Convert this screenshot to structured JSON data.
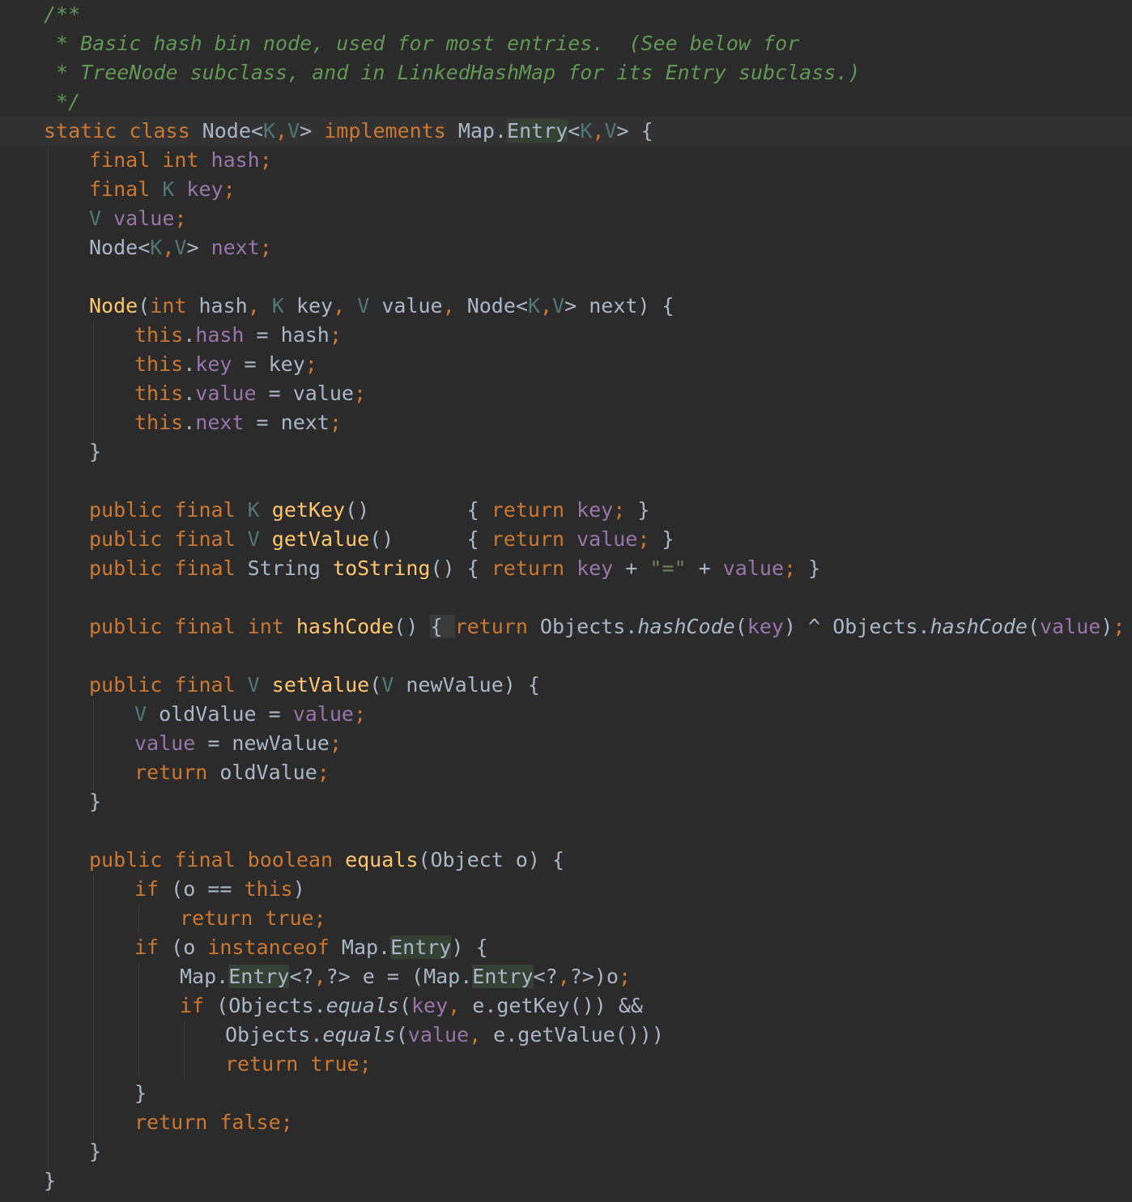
{
  "editor": {
    "colors": {
      "background": "#2b2b2b",
      "current_line": "#323232",
      "doc_comment": "#629755",
      "keyword": "#cc7832",
      "field": "#9876aa",
      "type_param": "#507874",
      "plain": "#a9b7c6",
      "method_decl": "#ffc66d",
      "string": "#6a8759"
    },
    "lines": [
      {
        "indent": 0,
        "tokens": [
          [
            "c-doc",
            "/**"
          ]
        ]
      },
      {
        "indent": 0,
        "tokens": [
          [
            "c-doc",
            " * Basic hash bin node, used for most entries.  (See below for"
          ]
        ]
      },
      {
        "indent": 0,
        "tokens": [
          [
            "c-doc",
            " * TreeNode subclass, and in LinkedHashMap for its Entry subclass.)"
          ]
        ]
      },
      {
        "indent": 0,
        "tokens": [
          [
            "c-doc",
            " */"
          ]
        ]
      },
      {
        "indent": 0,
        "current": true,
        "tokens": [
          [
            "c-kw",
            "static class "
          ],
          [
            "c-plain",
            "Node<"
          ],
          [
            "c-type",
            "K"
          ],
          [
            "c-punc",
            ","
          ],
          [
            "c-type",
            "V"
          ],
          [
            "c-plain",
            "> "
          ],
          [
            "c-kw",
            "implements "
          ],
          [
            "c-plain",
            "Map."
          ],
          [
            "c-plain hl-entry",
            "Entry"
          ],
          [
            "c-plain",
            "<"
          ],
          [
            "c-type",
            "K"
          ],
          [
            "c-punc",
            ","
          ],
          [
            "c-type",
            "V"
          ],
          [
            "c-plain",
            "> {"
          ]
        ]
      },
      {
        "indent": 1,
        "tokens": [
          [
            "c-kw",
            "final int "
          ],
          [
            "c-field",
            "hash"
          ],
          [
            "c-punc",
            ";"
          ]
        ]
      },
      {
        "indent": 1,
        "tokens": [
          [
            "c-kw",
            "final "
          ],
          [
            "c-type",
            "K "
          ],
          [
            "c-field",
            "key"
          ],
          [
            "c-punc",
            ";"
          ]
        ]
      },
      {
        "indent": 1,
        "tokens": [
          [
            "c-type",
            "V "
          ],
          [
            "c-field",
            "value"
          ],
          [
            "c-punc",
            ";"
          ]
        ]
      },
      {
        "indent": 1,
        "tokens": [
          [
            "c-plain",
            "Node<"
          ],
          [
            "c-type",
            "K"
          ],
          [
            "c-punc",
            ","
          ],
          [
            "c-type",
            "V"
          ],
          [
            "c-plain",
            "> "
          ],
          [
            "c-field",
            "next"
          ],
          [
            "c-punc",
            ";"
          ]
        ]
      },
      {
        "indent": 0,
        "tokens": []
      },
      {
        "indent": 1,
        "tokens": [
          [
            "c-method",
            "Node"
          ],
          [
            "c-plain",
            "("
          ],
          [
            "c-kw",
            "int "
          ],
          [
            "c-plain",
            "hash"
          ],
          [
            "c-punc",
            ", "
          ],
          [
            "c-type",
            "K "
          ],
          [
            "c-plain",
            "key"
          ],
          [
            "c-punc",
            ", "
          ],
          [
            "c-type",
            "V "
          ],
          [
            "c-plain",
            "value"
          ],
          [
            "c-punc",
            ", "
          ],
          [
            "c-plain",
            "Node<"
          ],
          [
            "c-type",
            "K"
          ],
          [
            "c-punc",
            ","
          ],
          [
            "c-type",
            "V"
          ],
          [
            "c-plain",
            "> next) {"
          ]
        ]
      },
      {
        "indent": 2,
        "tokens": [
          [
            "c-kw",
            "this"
          ],
          [
            "c-plain",
            "."
          ],
          [
            "c-field",
            "hash "
          ],
          [
            "c-plain",
            "= hash"
          ],
          [
            "c-punc",
            ";"
          ]
        ]
      },
      {
        "indent": 2,
        "tokens": [
          [
            "c-kw",
            "this"
          ],
          [
            "c-plain",
            "."
          ],
          [
            "c-field",
            "key "
          ],
          [
            "c-plain",
            "= key"
          ],
          [
            "c-punc",
            ";"
          ]
        ]
      },
      {
        "indent": 2,
        "tokens": [
          [
            "c-kw",
            "this"
          ],
          [
            "c-plain",
            "."
          ],
          [
            "c-field",
            "value "
          ],
          [
            "c-plain",
            "= value"
          ],
          [
            "c-punc",
            ";"
          ]
        ]
      },
      {
        "indent": 2,
        "tokens": [
          [
            "c-kw",
            "this"
          ],
          [
            "c-plain",
            "."
          ],
          [
            "c-field",
            "next "
          ],
          [
            "c-plain",
            "= next"
          ],
          [
            "c-punc",
            ";"
          ]
        ]
      },
      {
        "indent": 1,
        "tokens": [
          [
            "c-plain",
            "}"
          ]
        ]
      },
      {
        "indent": 0,
        "tokens": []
      },
      {
        "indent": 1,
        "tokens": [
          [
            "c-kw",
            "public final "
          ],
          [
            "c-type",
            "K "
          ],
          [
            "c-method",
            "getKey"
          ],
          [
            "c-plain",
            "()        { "
          ],
          [
            "c-kw",
            "return "
          ],
          [
            "c-field",
            "key"
          ],
          [
            "c-punc",
            "; "
          ],
          [
            "c-plain",
            "}"
          ]
        ]
      },
      {
        "indent": 1,
        "tokens": [
          [
            "c-kw",
            "public final "
          ],
          [
            "c-type",
            "V "
          ],
          [
            "c-method",
            "getValue"
          ],
          [
            "c-plain",
            "()      { "
          ],
          [
            "c-kw",
            "return "
          ],
          [
            "c-field",
            "value"
          ],
          [
            "c-punc",
            "; "
          ],
          [
            "c-plain",
            "}"
          ]
        ]
      },
      {
        "indent": 1,
        "tokens": [
          [
            "c-kw",
            "public final "
          ],
          [
            "c-plain",
            "String "
          ],
          [
            "c-method",
            "toString"
          ],
          [
            "c-plain",
            "() { "
          ],
          [
            "c-kw",
            "return "
          ],
          [
            "c-field",
            "key "
          ],
          [
            "c-plain",
            "+ "
          ],
          [
            "c-str",
            "\"=\" "
          ],
          [
            "c-plain",
            "+ "
          ],
          [
            "c-field",
            "value"
          ],
          [
            "c-punc",
            "; "
          ],
          [
            "c-plain",
            "}"
          ]
        ]
      },
      {
        "indent": 0,
        "tokens": []
      },
      {
        "indent": 1,
        "tokens": [
          [
            "c-kw",
            "public final int "
          ],
          [
            "c-method",
            "hashCode"
          ],
          [
            "c-plain",
            "() "
          ],
          [
            "c-plain fold-box",
            "{ "
          ],
          [
            "c-kw",
            "return "
          ],
          [
            "c-plain",
            "Objects."
          ],
          [
            "c-italic",
            "hashCode"
          ],
          [
            "c-plain",
            "("
          ],
          [
            "c-field",
            "key"
          ],
          [
            "c-plain",
            ") ^ Objects."
          ],
          [
            "c-italic",
            "hashCode"
          ],
          [
            "c-plain",
            "("
          ],
          [
            "c-field",
            "value"
          ],
          [
            "c-plain",
            ")"
          ],
          [
            "c-punc",
            "; "
          ],
          [
            "c-plain fold-box",
            "}"
          ]
        ]
      },
      {
        "indent": 0,
        "tokens": []
      },
      {
        "indent": 1,
        "tokens": [
          [
            "c-kw",
            "public final "
          ],
          [
            "c-type",
            "V "
          ],
          [
            "c-method",
            "setValue"
          ],
          [
            "c-plain",
            "("
          ],
          [
            "c-type",
            "V "
          ],
          [
            "c-plain",
            "newValue) {"
          ]
        ]
      },
      {
        "indent": 2,
        "tokens": [
          [
            "c-type",
            "V "
          ],
          [
            "c-plain",
            "oldValue = "
          ],
          [
            "c-field",
            "value"
          ],
          [
            "c-punc",
            ";"
          ]
        ]
      },
      {
        "indent": 2,
        "tokens": [
          [
            "c-field",
            "value "
          ],
          [
            "c-plain",
            "= newValue"
          ],
          [
            "c-punc",
            ";"
          ]
        ]
      },
      {
        "indent": 2,
        "tokens": [
          [
            "c-kw",
            "return "
          ],
          [
            "c-plain",
            "oldValue"
          ],
          [
            "c-punc",
            ";"
          ]
        ]
      },
      {
        "indent": 1,
        "tokens": [
          [
            "c-plain",
            "}"
          ]
        ]
      },
      {
        "indent": 0,
        "tokens": []
      },
      {
        "indent": 1,
        "tokens": [
          [
            "c-kw",
            "public final boolean "
          ],
          [
            "c-method",
            "equals"
          ],
          [
            "c-plain",
            "(Object o) {"
          ]
        ]
      },
      {
        "indent": 2,
        "tokens": [
          [
            "c-kw",
            "if "
          ],
          [
            "c-plain",
            "(o == "
          ],
          [
            "c-kw",
            "this"
          ],
          [
            "c-plain",
            ")"
          ]
        ]
      },
      {
        "indent": 3,
        "tokens": [
          [
            "c-kw",
            "return true;"
          ]
        ]
      },
      {
        "indent": 2,
        "tokens": [
          [
            "c-kw",
            "if "
          ],
          [
            "c-plain",
            "(o "
          ],
          [
            "c-kw",
            "instanceof "
          ],
          [
            "c-plain",
            "Map."
          ],
          [
            "c-plain hl-entry",
            "Entry"
          ],
          [
            "c-plain",
            ") {"
          ]
        ]
      },
      {
        "indent": 3,
        "tokens": [
          [
            "c-plain",
            "Map."
          ],
          [
            "c-plain hl-entry",
            "Entry"
          ],
          [
            "c-plain",
            "<?"
          ],
          [
            "c-punc",
            ","
          ],
          [
            "c-plain",
            "?> e = (Map."
          ],
          [
            "c-plain hl-entry",
            "Entry"
          ],
          [
            "c-plain",
            "<?"
          ],
          [
            "c-punc",
            ","
          ],
          [
            "c-plain",
            "?>)o"
          ],
          [
            "c-punc",
            ";"
          ]
        ]
      },
      {
        "indent": 3,
        "tokens": [
          [
            "c-kw",
            "if "
          ],
          [
            "c-plain",
            "(Objects."
          ],
          [
            "c-italic",
            "equals"
          ],
          [
            "c-plain",
            "("
          ],
          [
            "c-field",
            "key"
          ],
          [
            "c-punc",
            ", "
          ],
          [
            "c-plain",
            "e.getKey()) &&"
          ]
        ]
      },
      {
        "indent": 4,
        "tokens": [
          [
            "c-plain",
            "Objects."
          ],
          [
            "c-italic",
            "equals"
          ],
          [
            "c-plain",
            "("
          ],
          [
            "c-field",
            "value"
          ],
          [
            "c-punc",
            ", "
          ],
          [
            "c-plain",
            "e.getValue()))"
          ]
        ]
      },
      {
        "indent": 4,
        "tokens": [
          [
            "c-kw",
            "return true;"
          ]
        ]
      },
      {
        "indent": 2,
        "tokens": [
          [
            "c-plain",
            "}"
          ]
        ]
      },
      {
        "indent": 2,
        "tokens": [
          [
            "c-kw",
            "return false;"
          ]
        ]
      },
      {
        "indent": 1,
        "tokens": [
          [
            "c-plain",
            "}"
          ]
        ]
      },
      {
        "indent": 0,
        "tokens": [
          [
            "c-plain",
            "}"
          ]
        ]
      }
    ]
  }
}
